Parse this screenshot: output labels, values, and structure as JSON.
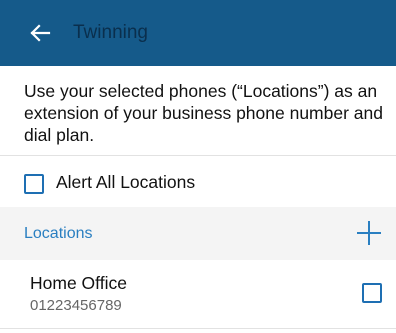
{
  "header": {
    "title": "Twinning",
    "back_icon": "arrow-left-icon",
    "background_color": "#155a8a"
  },
  "intro": {
    "text": "Use your selected phones (“Locations”) as an extension of your business phone number and dial plan."
  },
  "alert_all": {
    "label": "Alert All Locations",
    "checked": false
  },
  "locations": {
    "section_title": "Locations",
    "add_icon": "plus-icon",
    "accent_color": "#2a7fc1",
    "items": [
      {
        "name": "Home Office",
        "number": "01223456789",
        "checked": false
      }
    ]
  }
}
